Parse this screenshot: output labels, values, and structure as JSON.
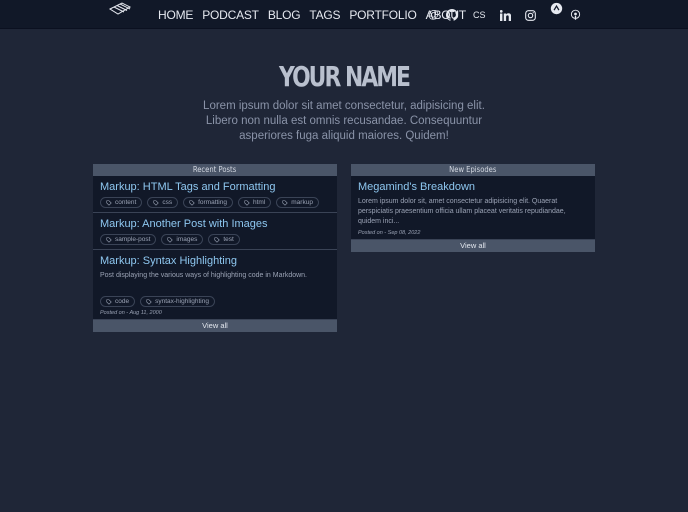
{
  "nav": {
    "links": [
      "HOME",
      "PODCAST",
      "BLOG",
      "TAGS",
      "PORTFOLIO",
      "ABOUT"
    ],
    "icons": [
      "at-icon",
      "github-icon",
      "codesandbox-icon",
      "linkedin-icon",
      "instagram-icon",
      "discord-icon",
      "podcast-icon"
    ],
    "cs_label": "CS",
    "at_label": "@"
  },
  "hero": {
    "title": "YOUR NAME",
    "subtitle": "Lorem ipsum dolor sit amet consectetur, adipisicing elit. Libero non nulla est omnis recusandae. Consequuntur asperiores fuga aliquid maiores. Quidem!"
  },
  "recent_posts": {
    "header": "Recent Posts",
    "view_all": "View all",
    "posts": [
      {
        "title": "Markup: HTML Tags and Formatting",
        "tags": [
          "content",
          "css",
          "formatting",
          "html",
          "markup"
        ]
      },
      {
        "title": "Markup: Another Post with Images",
        "tags": [
          "sample-post",
          "images",
          "test"
        ]
      },
      {
        "title": "Markup: Syntax Highlighting",
        "description": "Post displaying the various ways of highlighting code in Markdown.",
        "tags": [
          "code",
          "syntax-highlighting"
        ],
        "posted": "Posted on - Aug 11, 2000"
      }
    ]
  },
  "new_episodes": {
    "header": "New Episodes",
    "view_all": "View all",
    "episodes": [
      {
        "title": "Megamind's Breakdown",
        "description": "Lorem ipsum dolor sit, amet consectetur adipisicing elit. Quaerat perspiciatis praesentium officia ullam placeat veritatis repudiandae, quidem inci...",
        "posted": "Posted on - Sep 08, 2022"
      }
    ]
  }
}
